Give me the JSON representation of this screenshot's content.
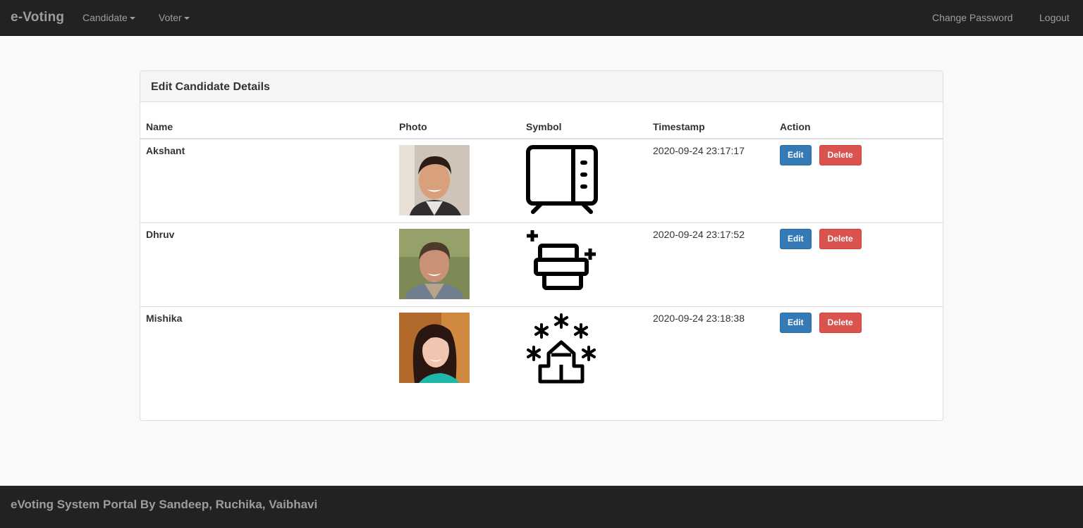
{
  "navbar": {
    "brand": "e-Voting",
    "menus": [
      {
        "label": "Candidate"
      },
      {
        "label": "Voter"
      }
    ],
    "right": {
      "change_password": "Change Password",
      "logout": "Logout"
    }
  },
  "panel": {
    "title": "Edit Candidate Details"
  },
  "table": {
    "headers": {
      "name": "Name",
      "photo": "Photo",
      "symbol": "Symbol",
      "timestamp": "Timestamp",
      "action": "Action"
    },
    "rows": [
      {
        "name": "Akshant",
        "timestamp": "2020-09-24 23:17:17",
        "photo_icon": "person-photo",
        "symbol_icon": "tv-icon",
        "edit_label": "Edit",
        "delete_label": "Delete"
      },
      {
        "name": "Dhruv",
        "timestamp": "2020-09-24 23:17:52",
        "photo_icon": "person-photo",
        "symbol_icon": "stacked-blocks-icon",
        "edit_label": "Edit",
        "delete_label": "Delete"
      },
      {
        "name": "Mishika",
        "timestamp": "2020-09-24 23:18:38",
        "photo_icon": "person-photo",
        "symbol_icon": "house-stars-icon",
        "edit_label": "Edit",
        "delete_label": "Delete"
      }
    ]
  },
  "footer": {
    "text": "eVoting System Portal By Sandeep, Ruchika, Vaibhavi"
  },
  "colors": {
    "navbar_bg": "#222222",
    "nav_text": "#9d9d9d",
    "primary": "#337ab7",
    "danger": "#d9534f"
  }
}
